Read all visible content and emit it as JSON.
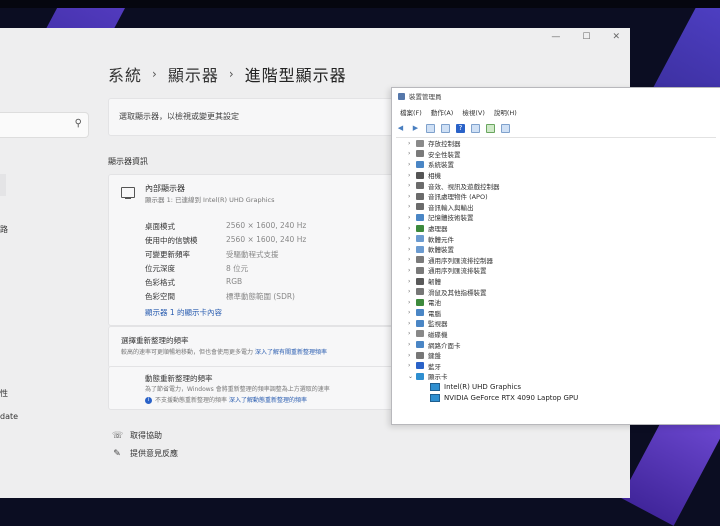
{
  "settings": {
    "breadcrumb": [
      "系統",
      "顯示器",
      "進階型顯示器"
    ],
    "left_nav": [
      "路",
      "性",
      "date"
    ],
    "select_display": "選取顯示器，以檢視或變更其設定",
    "section_title": "顯示器資訊",
    "display": {
      "name": "內部顯示器",
      "subtitle": "顯示器 1: 已連線到 Intel(R) UHD Graphics",
      "rows": [
        {
          "label": "桌面模式",
          "value": "2560 × 1600, 240 Hz"
        },
        {
          "label": "使用中的信號模",
          "value": "2560 × 1600, 240 Hz"
        },
        {
          "label": "可變更新頻率",
          "value": "受驅動程式支援"
        },
        {
          "label": "位元深度",
          "value": "8 位元"
        },
        {
          "label": "色彩格式",
          "value": "RGB"
        },
        {
          "label": "色彩空間",
          "value": "標準動態範圍 (SDR)"
        }
      ],
      "adapter_link": "顯示器 1 的顯示卡內容"
    },
    "refresh": {
      "title": "選擇重新整理的頻率",
      "desc": "較高的速率可更順暢地移動，但也會使用更多電力",
      "link": "深入了解有關重新整理頻率"
    },
    "dynamic": {
      "title": "動態重新整理的頻率",
      "desc": "為了節省電力，Windows 會將重新整理的頻率調整為上方選取的速率",
      "note": "不支援動態重新整理的頻率",
      "link": "深入了解動態重新整理的頻率"
    },
    "help": [
      "取得協助",
      "提供意見反應"
    ]
  },
  "devmgr": {
    "title": "裝置管理員",
    "menu": [
      "檔案(F)",
      "動作(A)",
      "檢視(V)",
      "說明(H)"
    ],
    "categories": [
      {
        "label": "存放控制器",
        "color": "#8a8a8a"
      },
      {
        "label": "安全性裝置",
        "color": "#7a7a7a"
      },
      {
        "label": "系統裝置",
        "color": "#4a86c5"
      },
      {
        "label": "相機",
        "color": "#555555"
      },
      {
        "label": "音效、視訊及遊戲控制器",
        "color": "#6b6b6b"
      },
      {
        "label": "音訊處理物件 (APO)",
        "color": "#6b6b6b"
      },
      {
        "label": "音訊輸入與輸出",
        "color": "#6b6b6b"
      },
      {
        "label": "記憶體技術裝置",
        "color": "#4a86c5"
      },
      {
        "label": "處理器",
        "color": "#3d8a3d"
      },
      {
        "label": "軟體元件",
        "color": "#6b9bd0"
      },
      {
        "label": "軟體裝置",
        "color": "#6b9bd0"
      },
      {
        "label": "通用序列匯流排控制器",
        "color": "#7a7a7a"
      },
      {
        "label": "通用序列匯流排裝置",
        "color": "#7a7a7a"
      },
      {
        "label": "韌體",
        "color": "#5a5a5a"
      },
      {
        "label": "滑鼠及其他指標裝置",
        "color": "#777777"
      },
      {
        "label": "電池",
        "color": "#3d8a3d"
      },
      {
        "label": "電腦",
        "color": "#4a86c5"
      },
      {
        "label": "監視器",
        "color": "#4a86c5"
      },
      {
        "label": "磁碟機",
        "color": "#888888"
      },
      {
        "label": "網路介面卡",
        "color": "#4a86c5"
      },
      {
        "label": "鍵盤",
        "color": "#777777"
      },
      {
        "label": "藍牙",
        "color": "#2a62c8"
      },
      {
        "label": "顯示卡",
        "color": "#2f8fd0",
        "expanded": true
      }
    ],
    "children": [
      "Intel(R) UHD Graphics",
      "NVIDIA GeForce RTX 4090 Laptop GPU"
    ]
  }
}
